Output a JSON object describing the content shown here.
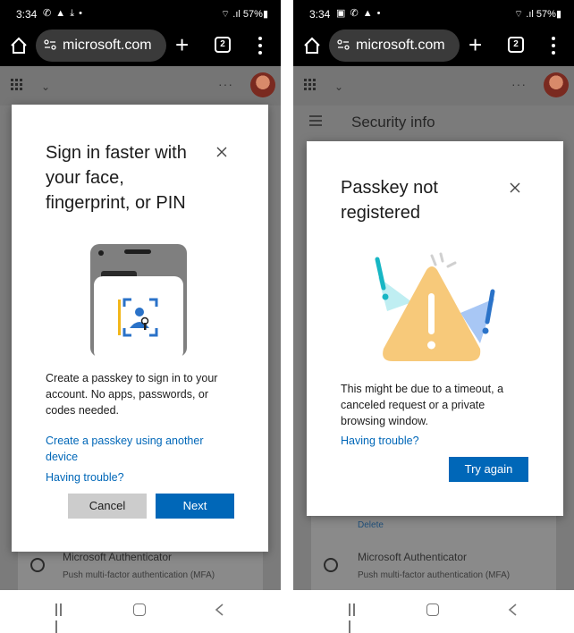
{
  "status": {
    "time": "3:34",
    "battery": "57%",
    "left_notif": "✆ ▲ ⤓ •",
    "right_notif": "▣ ✆ ▲ •",
    "signal": "⌔ .ıl"
  },
  "browser": {
    "url": "microsoft.com",
    "tab_count": "2"
  },
  "left": {
    "modal": {
      "title_line1": "Sign in faster with",
      "title_line2": "your face,",
      "title_line3": "fingerprint, or PIN",
      "body_line1": "Create a passkey to sign in to your",
      "body_line2": "account. No apps, passwords, or",
      "body_line3": "codes needed.",
      "link_another_line1": "Create a passkey using another",
      "link_another_line2": "device",
      "link_trouble": "Having trouble?",
      "cancel_label": "Cancel",
      "next_label": "Next"
    },
    "bg": {
      "auth_title": "Microsoft Authenticator",
      "auth_sub": "Push multi-factor authentication (MFA)"
    }
  },
  "right": {
    "header_title": "Security info",
    "modal": {
      "title_line1": "Passkey not",
      "title_line2": "registered",
      "body_line1": "This might be due to a timeout, a",
      "body_line2": "canceled request or a private",
      "body_line3": "browsing window.",
      "link_trouble": "Having trouble?",
      "try_again_label": "Try again"
    },
    "bg": {
      "delete_label": "Delete",
      "auth_title": "Microsoft Authenticator",
      "auth_sub": "Push multi-factor authentication (MFA)"
    }
  },
  "colors": {
    "accent": "#0067b8",
    "overlay": "#7b7b7b",
    "warning": "#f7c97a"
  }
}
